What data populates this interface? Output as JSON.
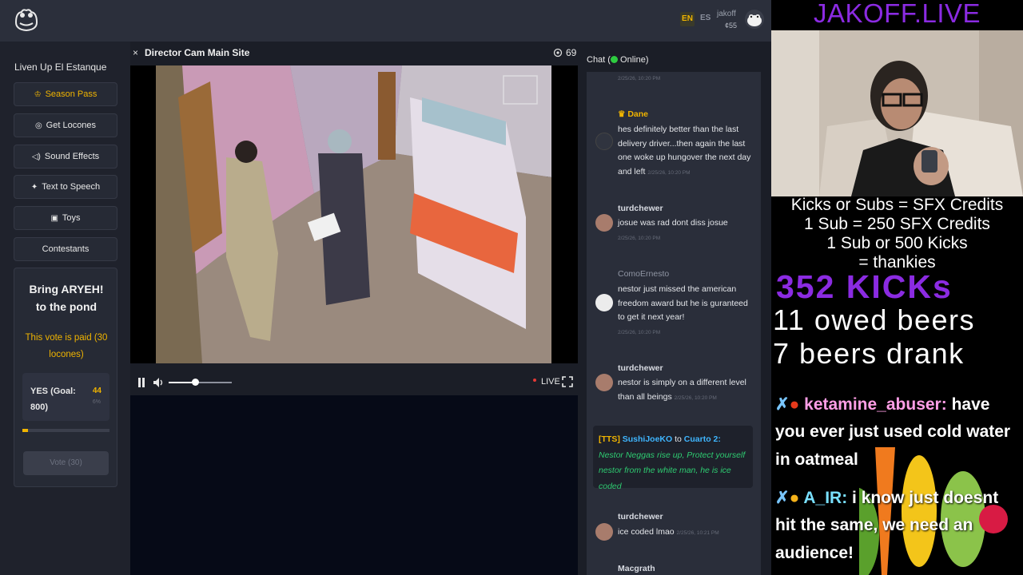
{
  "header": {
    "lang_en": "EN",
    "lang_es": "ES",
    "username": "jakoff",
    "coins": "¢55"
  },
  "sidebar": {
    "site_title": "Liven Up El Estanque",
    "items": [
      {
        "label": "Season Pass",
        "icon": "crown-icon"
      },
      {
        "label": "Get Locones",
        "icon": "coin-icon"
      },
      {
        "label": "Sound Effects",
        "icon": "speaker-icon"
      },
      {
        "label": "Text to Speech",
        "icon": "sparkle-icon"
      },
      {
        "label": "Toys",
        "icon": "gift-icon"
      },
      {
        "label": "Contestants",
        "icon": ""
      }
    ],
    "vote": {
      "title_line1": "Bring ARYEH!",
      "title_line2": "to the pond",
      "paid_text": "This vote is paid (30 locones)",
      "option_label": "YES (Goal: 800)",
      "option_count": "44",
      "option_pct": "6%",
      "progress_fraction": 0.06,
      "button_label": "Vote (30)"
    }
  },
  "player": {
    "close": "×",
    "title": "Director Cam Main Site",
    "viewers": "69",
    "live_label": "LIVE",
    "volume_fraction": 0.42
  },
  "chat": {
    "title": "Chat (",
    "status": " Online)",
    "top_time": "2/25/26, 10:20 PM",
    "messages": [
      {
        "user": "Dane",
        "text": "hes definitely better than the last delivery driver...then again the last one woke up hungover the next day and left",
        "time": "2/25/26, 10:20 PM"
      },
      {
        "user": "turdchewer",
        "text": "josue was rad dont diss josue",
        "time": "2/25/26, 10:20 PM"
      },
      {
        "user": "ComoErnesto",
        "text": "nestor just missed the american freedom award but he is guranteed to get it next year!",
        "time": "2/25/26, 10:20 PM"
      },
      {
        "user": "turdchewer",
        "text": "nestor is simply on a different level than all beings",
        "time": "2/25/26, 10:20 PM"
      },
      {
        "user": "turdchewer",
        "text": "ice coded lmao",
        "time": "2/25/26, 10:21 PM"
      },
      {
        "user": "Macgrath",
        "text": "",
        "time": ""
      }
    ],
    "tts": {
      "tag": "[TTS]",
      "from": "SushiJoeKO",
      "to_word": "to",
      "to": "Cuarto 2:",
      "text": "Nestor Neggas rise up, Protect yourself nestor from the white man, he is ice coded"
    }
  },
  "stream": {
    "title": "JAKOFF.LIVE",
    "sfx_lines": [
      "Kicks or Subs = SFX Credits",
      "1 Sub = 250 SFX Credits",
      "1 Sub or 500 Kicks",
      "= thankies"
    ],
    "kicks": "352 KICKs",
    "owed": "11 owed beers",
    "drank": "7 beers drank",
    "chat_lines": [
      {
        "user": "ketamine_abuser:",
        "text": " have"
      },
      {
        "user": "",
        "text": "you ever just used cold water"
      },
      {
        "user": "",
        "text": "in oatmeal"
      },
      {
        "user": "A_IR:",
        "text": " i know just doesnt"
      },
      {
        "user": "",
        "text": "hit the same, we need an"
      },
      {
        "user": "",
        "text": "audience!"
      }
    ]
  }
}
